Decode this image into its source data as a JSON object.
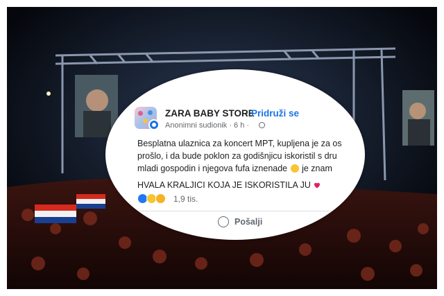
{
  "post": {
    "group_name": "ZARA BABY STORE",
    "separator": "·",
    "join_label": "Pridruži se",
    "author_meta": "Anonimni sudionik · 6 h ·",
    "text_lines": [
      "Besplatna ulaznica za koncert MPT, kupljena je za os",
      "prošlo, i da bude poklon za godišnjicu iskoristil s dru",
      "mladi gospodin i njegova fufa iznenade",
      "je znam"
    ],
    "caption": "HVALA KRALJICI KOJA JE ISKORISTILA JU",
    "reaction_count": "1,9 tis.",
    "share_label": "Pošalji"
  },
  "colors": {
    "brand_blue": "#1b74e4",
    "like_blue": "#2078f4",
    "haha_yellow": "#f7c531",
    "heart_red": "#e0245e"
  },
  "icons": {
    "avatar": "group-avatar",
    "badge": "anonymous-badge-icon",
    "globe": "globe-icon",
    "share": "whatsapp-icon"
  }
}
